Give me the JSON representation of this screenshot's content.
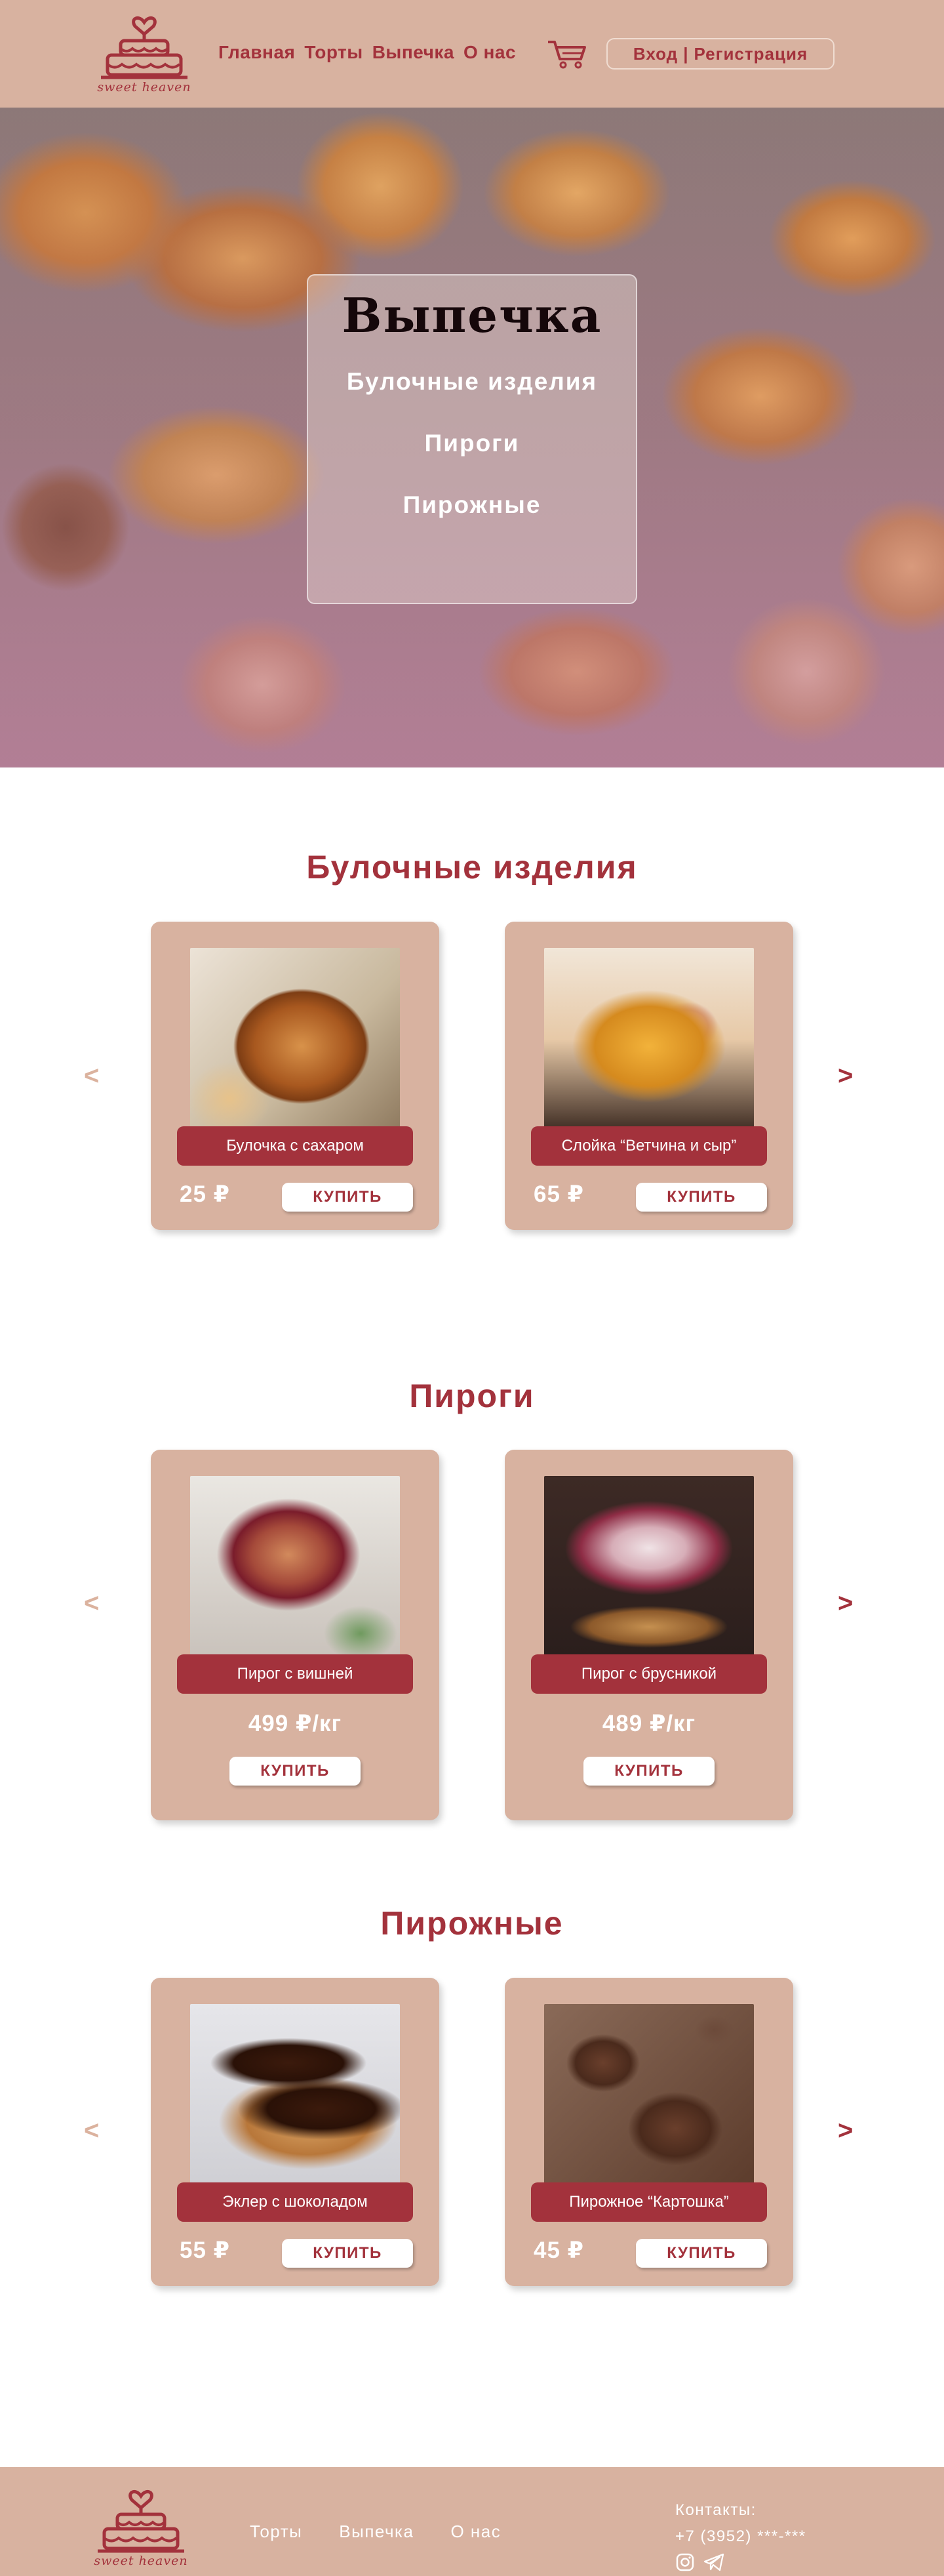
{
  "brand": {
    "logo_text": "sweet heaven"
  },
  "header": {
    "nav": [
      "Главная",
      "Торты",
      "Выпечка",
      "О нас"
    ],
    "auth": {
      "login": "Вход",
      "separator": "|",
      "register": "Регистрация"
    }
  },
  "hero": {
    "title": "Выпечка",
    "links": [
      "Булочные изделия",
      "Пироги",
      "Пирожные"
    ]
  },
  "arrows": {
    "prev": "<",
    "next": ">"
  },
  "sections": [
    {
      "title": "Булочные изделия",
      "products": [
        {
          "name": "Булочка с сахаром",
          "price": "25 ₽",
          "buy": "КУПИТЬ",
          "photo": "sugar-bun"
        },
        {
          "name": "Слойка “Ветчина и сыр”",
          "price": "65 ₽",
          "buy": "КУПИТЬ",
          "photo": "ham-cheese-puff"
        }
      ]
    },
    {
      "title": "Пироги",
      "products": [
        {
          "name": "Пирог с вишней",
          "price": "499 ₽/кг",
          "buy": "КУПИТЬ",
          "photo": "cherry-pie"
        },
        {
          "name": "Пирог с брусникой",
          "price": "489 ₽/кг",
          "buy": "КУПИТЬ",
          "photo": "lingonberry-pie"
        }
      ]
    },
    {
      "title": "Пирожные",
      "products": [
        {
          "name": "Эклер с шоколадом",
          "price": "55 ₽",
          "buy": "КУПИТЬ",
          "photo": "chocolate-eclair"
        },
        {
          "name": "Пирожное “Картошка”",
          "price": "45 ₽",
          "buy": "КУПИТЬ",
          "photo": "kartoshka-cake"
        }
      ]
    }
  ],
  "footer": {
    "nav": [
      "Торты",
      "Выпечка",
      "О нас"
    ],
    "contacts_label": "Контакты:",
    "phone": "+7 (3952) ***-***",
    "social_icons": [
      "instagram-icon",
      "telegram-icon"
    ]
  },
  "colors": {
    "accent": "#a3323c",
    "beige": "#d8b2a0",
    "muted_arrow": "#dbb29e",
    "white": "#ffffff"
  }
}
